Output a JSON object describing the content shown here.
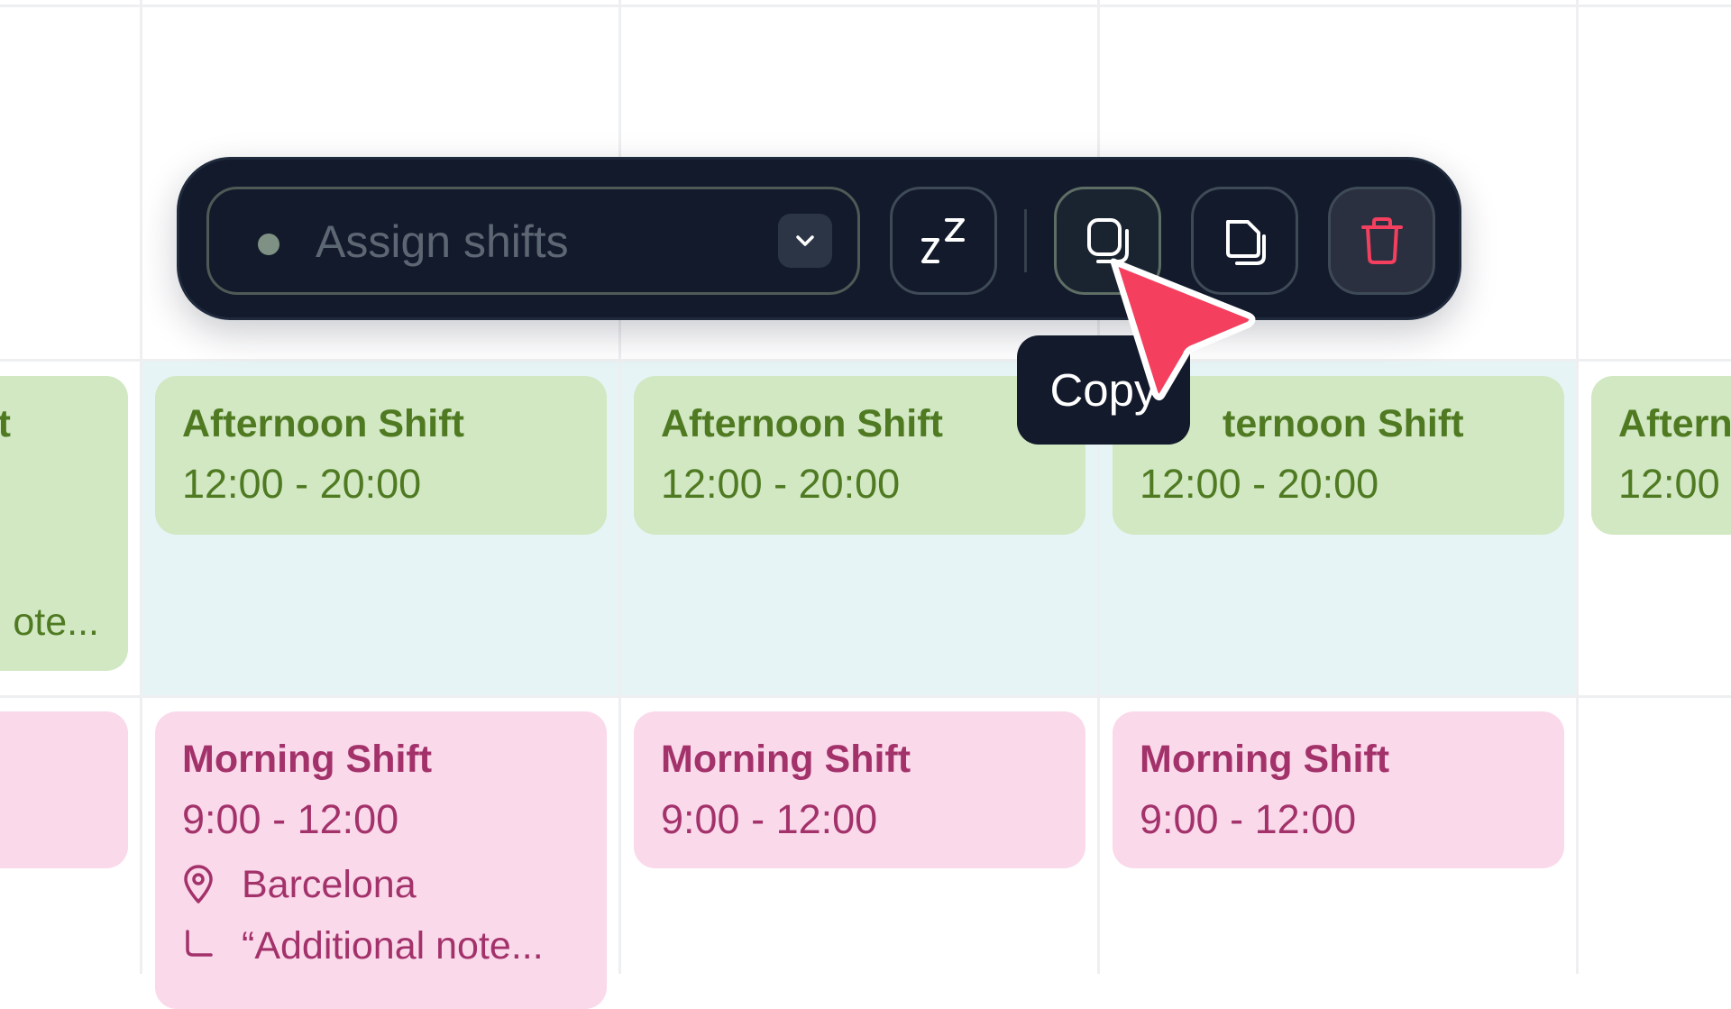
{
  "toolbar": {
    "assign_placeholder": "Assign shifts",
    "actions": [
      "sleep-icon",
      "copy-icon",
      "duplicate-icon",
      "trash-icon"
    ]
  },
  "tooltip": {
    "label": "Copy"
  },
  "row1": [
    {
      "title": "t",
      "time": "",
      "note": "ote..."
    },
    {
      "title": "Afternoon Shift",
      "time": "12:00 - 20:00"
    },
    {
      "title": "Afternoon Shift",
      "time": "12:00 - 20:00"
    },
    {
      "title": "ternoon Shift",
      "time": "12:00 - 20:00"
    },
    {
      "title": "Aftern",
      "time": "12:00"
    }
  ],
  "row2": [
    {
      "title": "Morning Shift",
      "time": "9:00 - 12:00",
      "location": "Barcelona",
      "note": "“Additional note..."
    },
    {
      "title": "Morning Shift",
      "time": "9:00 - 12:00"
    },
    {
      "title": "Morning Shift",
      "time": "9:00 - 12:00"
    }
  ],
  "colors": {
    "afternoon_bg": "#d1e8c3",
    "afternoon_text": "#4f7a22",
    "morning_bg": "#fad9ea",
    "morning_text": "#a3326b",
    "toolbar_bg": "#121a2b",
    "selected_row": "#e6f4f5",
    "cursor": "#f43f5e",
    "delete_icon": "#f43f5e"
  }
}
